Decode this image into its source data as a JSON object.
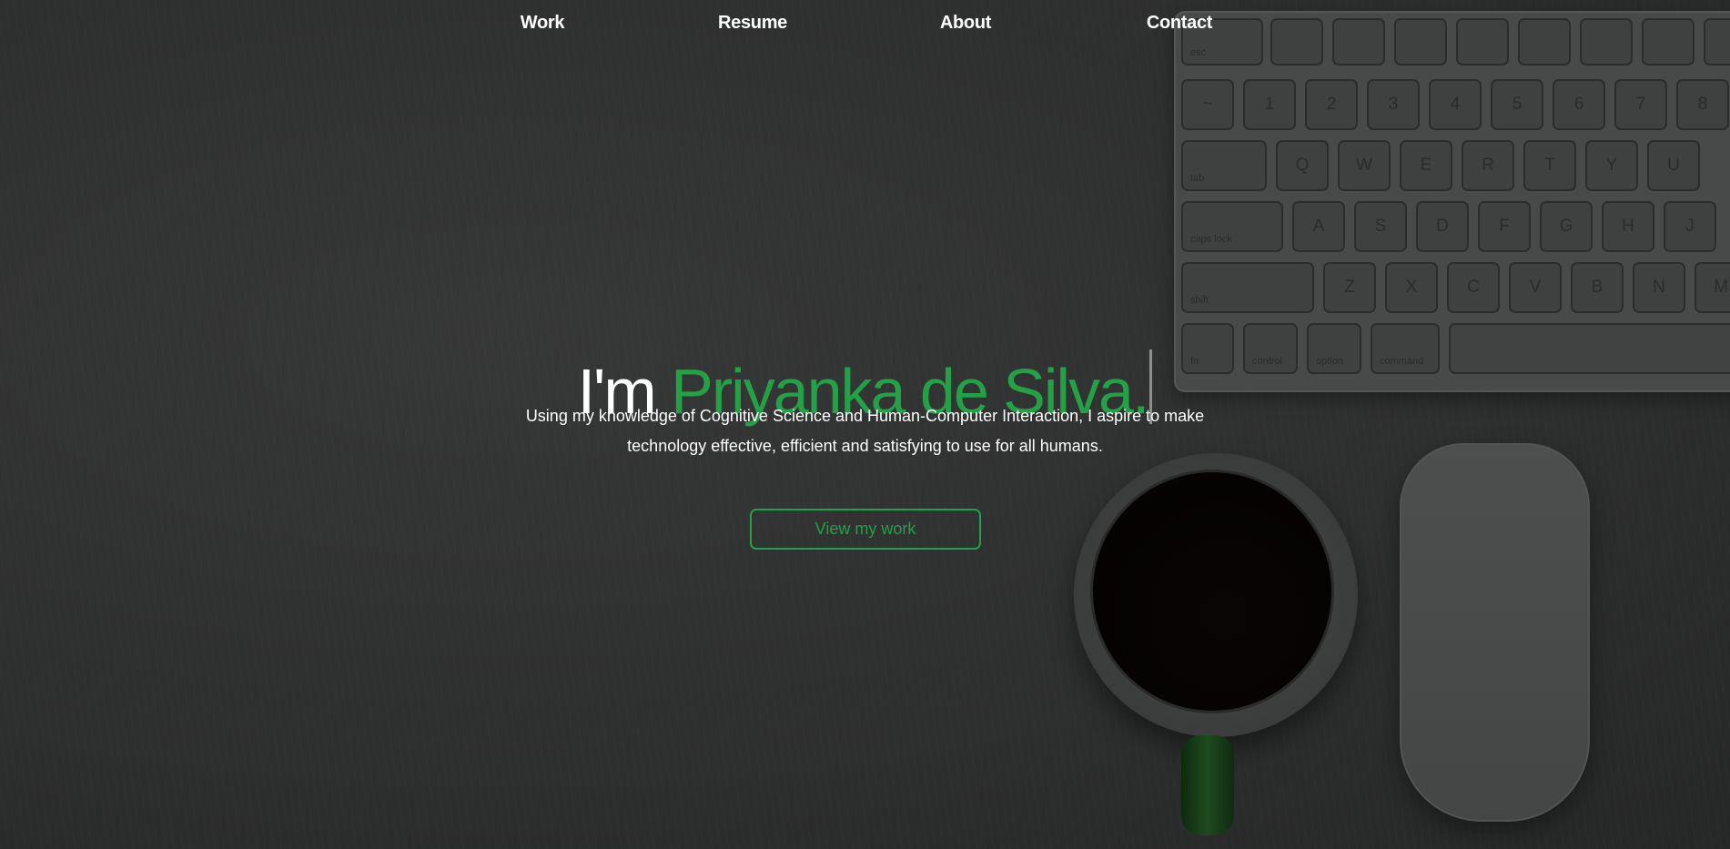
{
  "nav": {
    "items": [
      {
        "label": "Work"
      },
      {
        "label": "Resume"
      },
      {
        "label": "About"
      },
      {
        "label": "Contact"
      }
    ]
  },
  "hero": {
    "prefix": "I'm ",
    "name": "Priyanka de Silva.",
    "tagline_line1": "Using my knowledge of Cognitive Science and Human-Computer Interaction, I aspire to make",
    "tagline_line2": "technology effective, efficient and satisfying to use for all humans.",
    "cta_label": "View my work"
  },
  "colors": {
    "accent": "#24a046",
    "background": "#2f3030",
    "text": "#ffffff"
  },
  "keyboard": {
    "row_fn": [
      "esc",
      "",
      "",
      "",
      "",
      "",
      "",
      "",
      ""
    ],
    "row_num": [
      "~",
      "1",
      "2",
      "3",
      "4",
      "5",
      "6",
      "7",
      "8"
    ],
    "row_q": [
      "tab",
      "Q",
      "W",
      "E",
      "R",
      "T",
      "Y",
      "U"
    ],
    "row_a": [
      "caps lock",
      "A",
      "S",
      "D",
      "F",
      "G",
      "H",
      "J"
    ],
    "row_z": [
      "shift",
      "Z",
      "X",
      "C",
      "V",
      "B",
      "N",
      "M"
    ],
    "row_mod": [
      "fn",
      "control",
      "option",
      "command"
    ]
  }
}
